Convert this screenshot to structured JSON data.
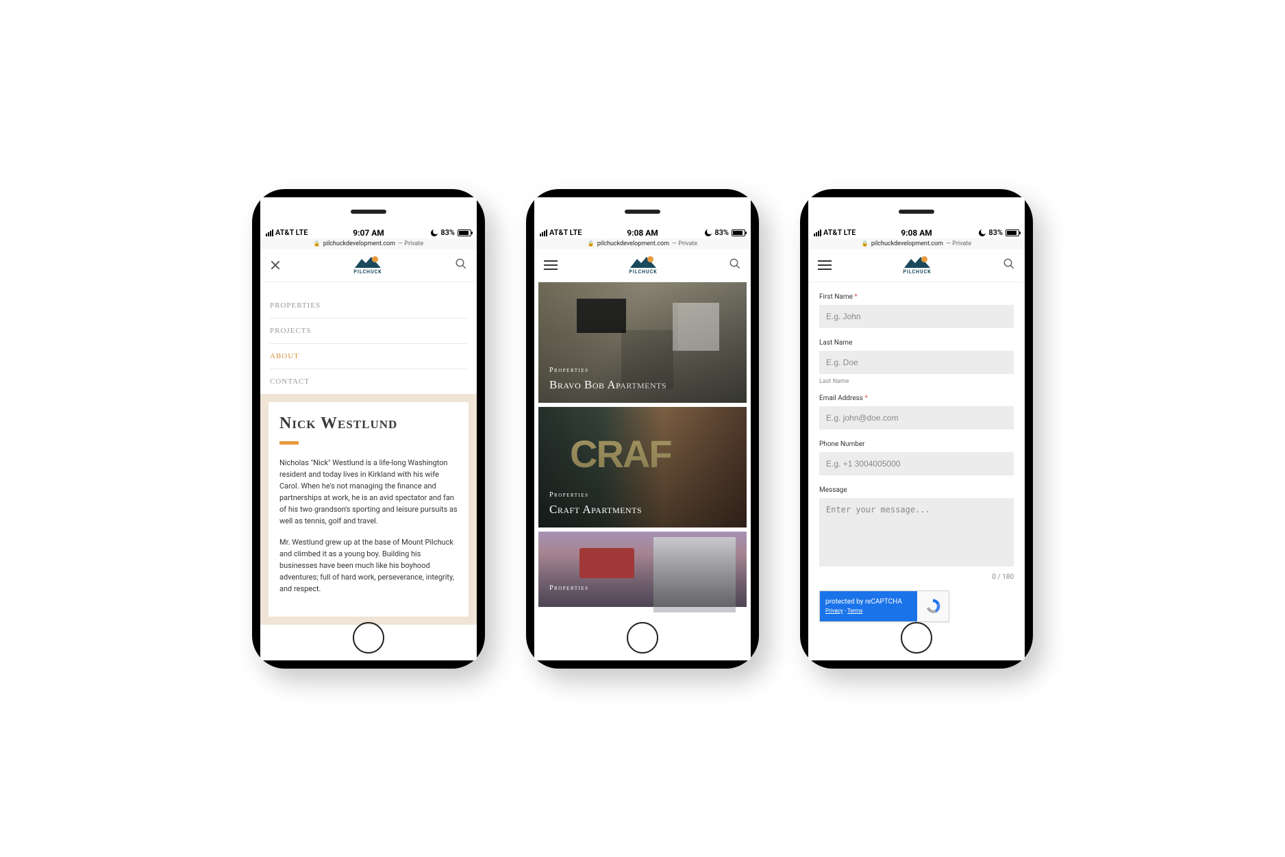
{
  "status": {
    "carrier": "AT&T  LTE",
    "time1": "9:07 AM",
    "time2": "9:08 AM",
    "time3": "9:08 AM",
    "battery": "83%"
  },
  "url": {
    "domain": "pilchuckdevelopment.com",
    "suffix": " — Private"
  },
  "logo_text": "PILCHUCK",
  "nav": {
    "properties": "Properties",
    "projects": "Projects",
    "about": "About",
    "contact": "Contact"
  },
  "about": {
    "heading": "Nick Westlund",
    "p1": "Nicholas \"Nick\" Westlund is a life-long Washington resident and today lives in Kirkland with his wife Carol. When he's not managing the finance and partnerships at work, he is an avid spectator and fan of his two grandson's sporting and leisure pursuits as well as tennis, golf and travel.",
    "p2": "Mr. Westlund grew up at the base of Mount Pilchuck and climbed it as a young boy. Building his businesses have been much like his boyhood adventures; full of hard work, perseverance, integrity, and respect."
  },
  "properties": {
    "cat": "Properties",
    "card1": "Bravo Bob Apartments",
    "card2": "Craft Apartments",
    "card3": "Properties"
  },
  "form": {
    "first_name_label": "First Name",
    "first_name_ph": "E.g. John",
    "last_name_label": "Last Name",
    "last_name_ph": "E.g. Doe",
    "last_name_hint": "Last Name",
    "email_label": "Email Address",
    "email_ph": "E.g. john@doe.com",
    "phone_label": "Phone Number",
    "phone_ph": "E.g. +1 3004005000",
    "message_label": "Message",
    "message_ph": "Enter your message...",
    "counter": "0 / 180",
    "recaptcha_main": "protected by reCAPTCHA",
    "recaptcha_privacy": "Privacy",
    "recaptcha_terms": "Terms",
    "asterisk": " *"
  }
}
